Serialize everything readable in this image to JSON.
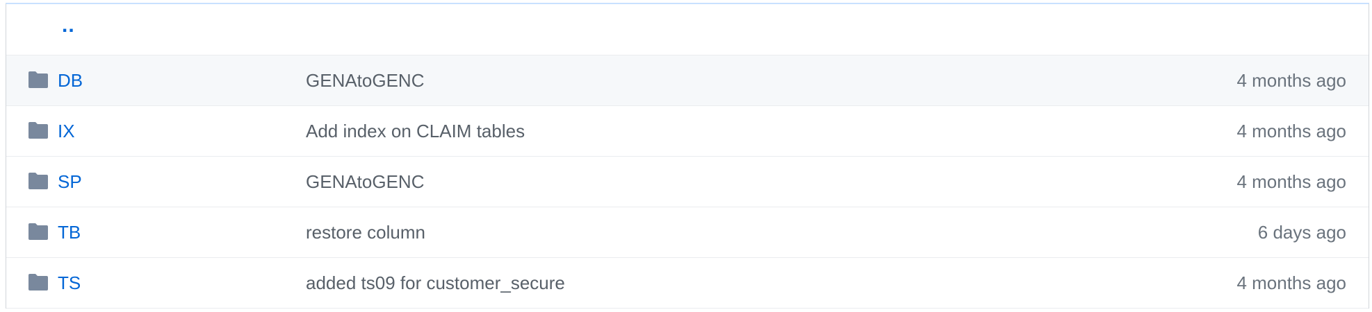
{
  "parent_link": "..",
  "icon_color": "#79889d",
  "link_color": "#0366d6",
  "rows": [
    {
      "icon": "folder-icon",
      "name": "DB",
      "message": "GENAtoGENC",
      "age": "4 months ago"
    },
    {
      "icon": "folder-icon",
      "name": "IX",
      "message": "Add index on CLAIM tables",
      "age": "4 months ago"
    },
    {
      "icon": "folder-icon",
      "name": "SP",
      "message": "GENAtoGENC",
      "age": "4 months ago"
    },
    {
      "icon": "folder-icon",
      "name": "TB",
      "message": "restore column",
      "age": "6 days ago"
    },
    {
      "icon": "folder-icon",
      "name": "TS",
      "message": "added ts09 for customer_secure",
      "age": "4 months ago"
    }
  ]
}
